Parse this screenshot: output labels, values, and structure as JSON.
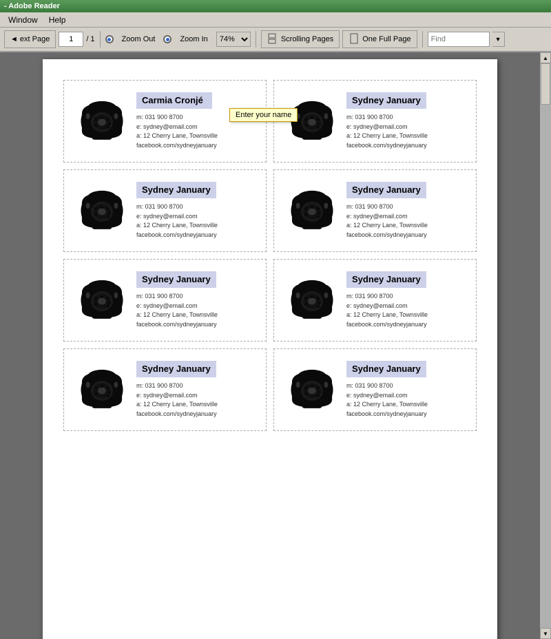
{
  "titlebar": {
    "text": "- Adobe Reader"
  },
  "menubar": {
    "items": [
      "Window",
      "Help"
    ]
  },
  "toolbar": {
    "prev_label": "ext Page",
    "page_current": "1",
    "page_total": "1",
    "zoom_out_label": "Zoom Out",
    "zoom_in_label": "Zoom In",
    "zoom_value": "74%",
    "scrolling_pages_label": "Scrolling Pages",
    "one_full_page_label": "One Full Page",
    "find_placeholder": "Find",
    "find_arrow": "▼"
  },
  "cards": [
    {
      "id": 1,
      "name": "Carmia Cronjé",
      "name_editable": true,
      "tooltip": "Enter your name",
      "phone": "m: 031 900 8700",
      "email": "e: sydney@email.com",
      "address": "a: 12 Cherry Lane, Townsville",
      "facebook": "facebook.com/sydneyjanuary",
      "highlight": true
    },
    {
      "id": 2,
      "name": "Sydney January",
      "name_editable": false,
      "phone": "m: 031 900 8700",
      "email": "e: sydney@email.com",
      "address": "a: 12 Cherry Lane, Townsville",
      "facebook": "facebook.com/sydneyjanuary",
      "highlight": true
    },
    {
      "id": 3,
      "name": "Sydney January",
      "name_editable": false,
      "phone": "m: 031 900 8700",
      "email": "e: sydney@email.com",
      "address": "a: 12 Cherry Lane, Townsville",
      "facebook": "facebook.com/sydneyjanuary",
      "highlight": false
    },
    {
      "id": 4,
      "name": "Sydney January",
      "name_editable": false,
      "phone": "m: 031 900 8700",
      "email": "e: sydney@email.com",
      "address": "a: 12 Cherry Lane, Townsville",
      "facebook": "facebook.com/sydneyjanuary",
      "highlight": false
    },
    {
      "id": 5,
      "name": "Sydney January",
      "name_editable": false,
      "phone": "m: 031 900 8700",
      "email": "e: sydney@email.com",
      "address": "a: 12 Cherry Lane, Townsville",
      "facebook": "facebook.com/sydneyjanuary",
      "highlight": false
    },
    {
      "id": 6,
      "name": "Sydney January",
      "name_editable": false,
      "phone": "m: 031 900 8700",
      "email": "e: sydney@email.com",
      "address": "a: 12 Cherry Lane, Townsville",
      "facebook": "facebook.com/sydneyjanuary",
      "highlight": false
    },
    {
      "id": 7,
      "name": "Sydney January",
      "name_editable": false,
      "phone": "m: 031 900 8700",
      "email": "e: sydney@email.com",
      "address": "a: 12 Cherry Lane, Townsville",
      "facebook": "facebook.com/sydneyjanuary",
      "highlight": false
    },
    {
      "id": 8,
      "name": "Sydney January",
      "name_editable": false,
      "phone": "m: 031 900 8700",
      "email": "e: sydney@email.com",
      "address": "a: 12 Cherry Lane, Townsville",
      "facebook": "facebook.com/sydneyjanuary",
      "highlight": false
    }
  ]
}
